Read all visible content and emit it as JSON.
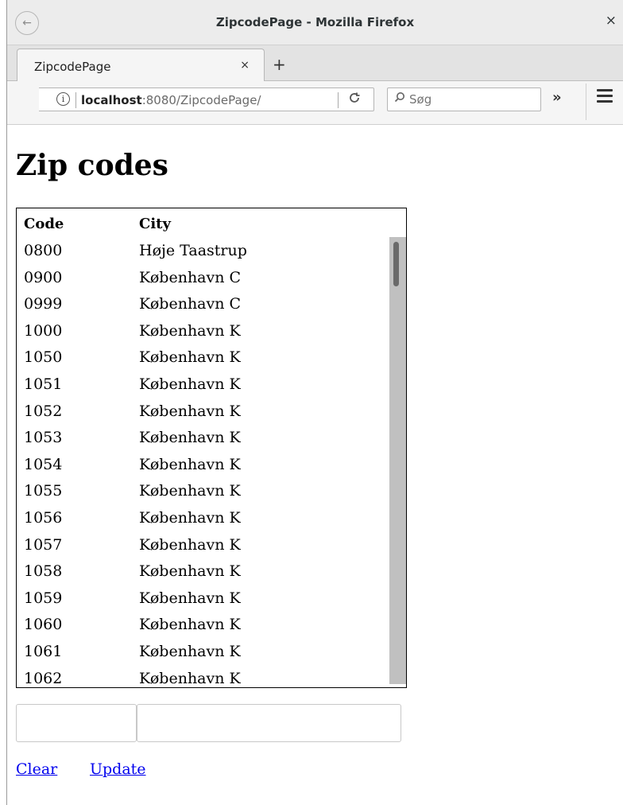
{
  "window": {
    "title": "ZipcodePage - Mozilla Firefox",
    "close_glyph": "×"
  },
  "tabs": [
    {
      "label": "ZipcodePage",
      "close_glyph": "×"
    }
  ],
  "newtab_glyph": "+",
  "navbar": {
    "back_glyph": "←",
    "info_glyph": "i",
    "url_host": "localhost",
    "url_rest": ":8080/ZipcodePage/",
    "reload_glyph": "C",
    "search_icon": "⚲",
    "search_placeholder": "Søg",
    "overflow_glyph": "»"
  },
  "page": {
    "heading": "Zip codes",
    "table": {
      "headers": [
        "Code",
        "City"
      ],
      "rows": [
        [
          "0800",
          "Høje Taastrup"
        ],
        [
          "0900",
          "København C"
        ],
        [
          "0999",
          "København C"
        ],
        [
          "1000",
          "København K"
        ],
        [
          "1050",
          "København K"
        ],
        [
          "1051",
          "København K"
        ],
        [
          "1052",
          "København K"
        ],
        [
          "1053",
          "København K"
        ],
        [
          "1054",
          "København K"
        ],
        [
          "1055",
          "København K"
        ],
        [
          "1056",
          "København K"
        ],
        [
          "1057",
          "København K"
        ],
        [
          "1058",
          "København K"
        ],
        [
          "1059",
          "København K"
        ],
        [
          "1060",
          "København K"
        ],
        [
          "1061",
          "København K"
        ],
        [
          "1062",
          "København K"
        ]
      ]
    },
    "code_input_value": "",
    "city_input_value": "",
    "links": {
      "clear": "Clear",
      "update": "Update"
    }
  }
}
